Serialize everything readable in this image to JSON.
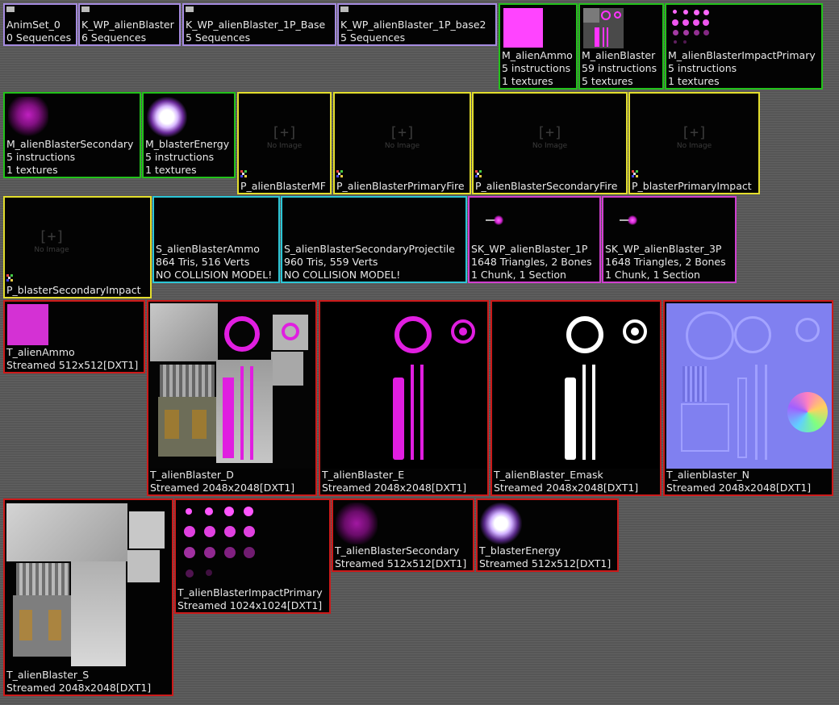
{
  "browser": {
    "assets": [
      {
        "name": "AnimSet_0",
        "info": [
          "0 Sequences"
        ]
      },
      {
        "name": "K_WP_alienBlaster",
        "info": [
          "6 Sequences"
        ]
      },
      {
        "name": "K_WP_alienBlaster_1P_Base",
        "info": [
          "5 Sequences"
        ]
      },
      {
        "name": "K_WP_alienBlaster_1P_base2",
        "info": [
          "5 Sequences"
        ]
      },
      {
        "name": "M_alienAmmo",
        "info": [
          "5 instructions",
          "1 textures"
        ]
      },
      {
        "name": "M_alienBlaster",
        "info": [
          "59 instructions",
          "5 textures"
        ]
      },
      {
        "name": "M_alienBlasterImpactPrimary",
        "info": [
          "5 instructions",
          "1 textures"
        ]
      },
      {
        "name": "M_alienBlasterSecondary",
        "info": [
          "5 instructions",
          "1 textures"
        ]
      },
      {
        "name": "M_blasterEnergy",
        "info": [
          "5 instructions",
          "1 textures"
        ]
      },
      {
        "name": "P_alienBlasterMF",
        "info": []
      },
      {
        "name": "P_alienBlasterPrimaryFire",
        "info": []
      },
      {
        "name": "P_alienBlasterSecondaryFire",
        "info": []
      },
      {
        "name": "P_blasterPrimaryImpact",
        "info": []
      },
      {
        "name": "P_blasterSecondaryImpact",
        "info": []
      },
      {
        "name": "S_alienBlasterAmmo",
        "info": [
          "864 Tris, 516 Verts",
          "NO COLLISION MODEL!"
        ]
      },
      {
        "name": "S_alienBlasterSecondaryProjectile",
        "info": [
          "960 Tris, 559 Verts",
          "NO COLLISION MODEL!"
        ]
      },
      {
        "name": "SK_WP_alienBlaster_1P",
        "info": [
          "1648 Triangles, 2 Bones",
          "1 Chunk, 1 Section"
        ]
      },
      {
        "name": "SK_WP_alienBlaster_3P",
        "info": [
          "1648 Triangles, 2 Bones",
          "1 Chunk, 1 Section"
        ]
      },
      {
        "name": "T_alienAmmo",
        "info": [
          "Streamed 512x512[DXT1]"
        ]
      },
      {
        "name": "T_alienBlaster_D",
        "info": [
          "Streamed 2048x2048[DXT1]"
        ]
      },
      {
        "name": "T_alienBlaster_E",
        "info": [
          "Streamed 2048x2048[DXT1]"
        ]
      },
      {
        "name": "T_alienBlaster_Emask",
        "info": [
          "Streamed 2048x2048[DXT1]"
        ]
      },
      {
        "name": "T_alienblaster_N",
        "info": [
          "Streamed 2048x2048[DXT1]"
        ]
      },
      {
        "name": "T_alienBlaster_S",
        "info": [
          "Streamed 2048x2048[DXT1]"
        ]
      },
      {
        "name": "T_alienBlasterImpactPrimary",
        "info": [
          "Streamed 1024x1024[DXT1]"
        ]
      },
      {
        "name": "T_alienBlasterSecondary",
        "info": [
          "Streamed 512x512[DXT1]"
        ]
      },
      {
        "name": "T_blasterEnergy",
        "info": [
          "Streamed 512x512[DXT1]"
        ]
      }
    ],
    "no_image_label": "No Image",
    "border_colors": {
      "animset": "#a58be0",
      "material": "#22c21a",
      "particle": "#e3de2c",
      "static_mesh": "#2cc6d6",
      "skeletal_mesh": "#d13fd0",
      "texture": "#cc1a1a"
    },
    "accent_color": "#ff33ff"
  }
}
